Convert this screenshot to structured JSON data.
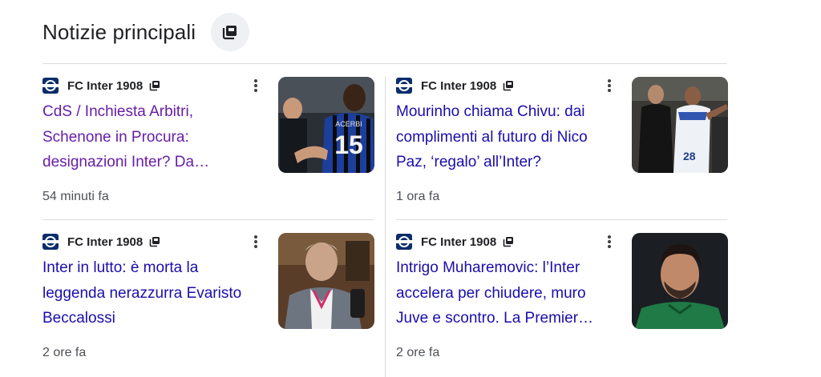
{
  "header": {
    "title": "Notizie principali",
    "icon": "news-stack-icon"
  },
  "cards": [
    {
      "source": "FC Inter 1908",
      "headline": "CdS / Inchiesta Arbitri, Schenone in Procura: designazioni Inter? Da…",
      "time": "54 minuti fa",
      "visited": true,
      "jersey_name": "ACERBI",
      "jersey_number": "15"
    },
    {
      "source": "FC Inter 1908",
      "headline": "Mourinho chiama Chivu: dai complimenti al futuro di Nico Paz, ‘regalo’ all’Inter?",
      "time": "1 ora fa",
      "visited": false,
      "jersey_number": "28"
    },
    {
      "source": "FC Inter 1908",
      "headline": "Inter in lutto: è morta la leggenda nerazzurra Evaristo Beccalossi",
      "time": "2 ore fa",
      "visited": false
    },
    {
      "source": "FC Inter 1908",
      "headline": "Intrigo Muharemovic: l’Inter accelera per chiudere, muro Juve e scontro. La Premier…",
      "time": "2 ore fa",
      "visited": false
    }
  ],
  "colors": {
    "headline_link": "#1a0dab",
    "headline_visited": "#681da8",
    "muted_text": "#4d5156",
    "divider": "#dadce0",
    "source_logo": "#0b2d6b"
  }
}
